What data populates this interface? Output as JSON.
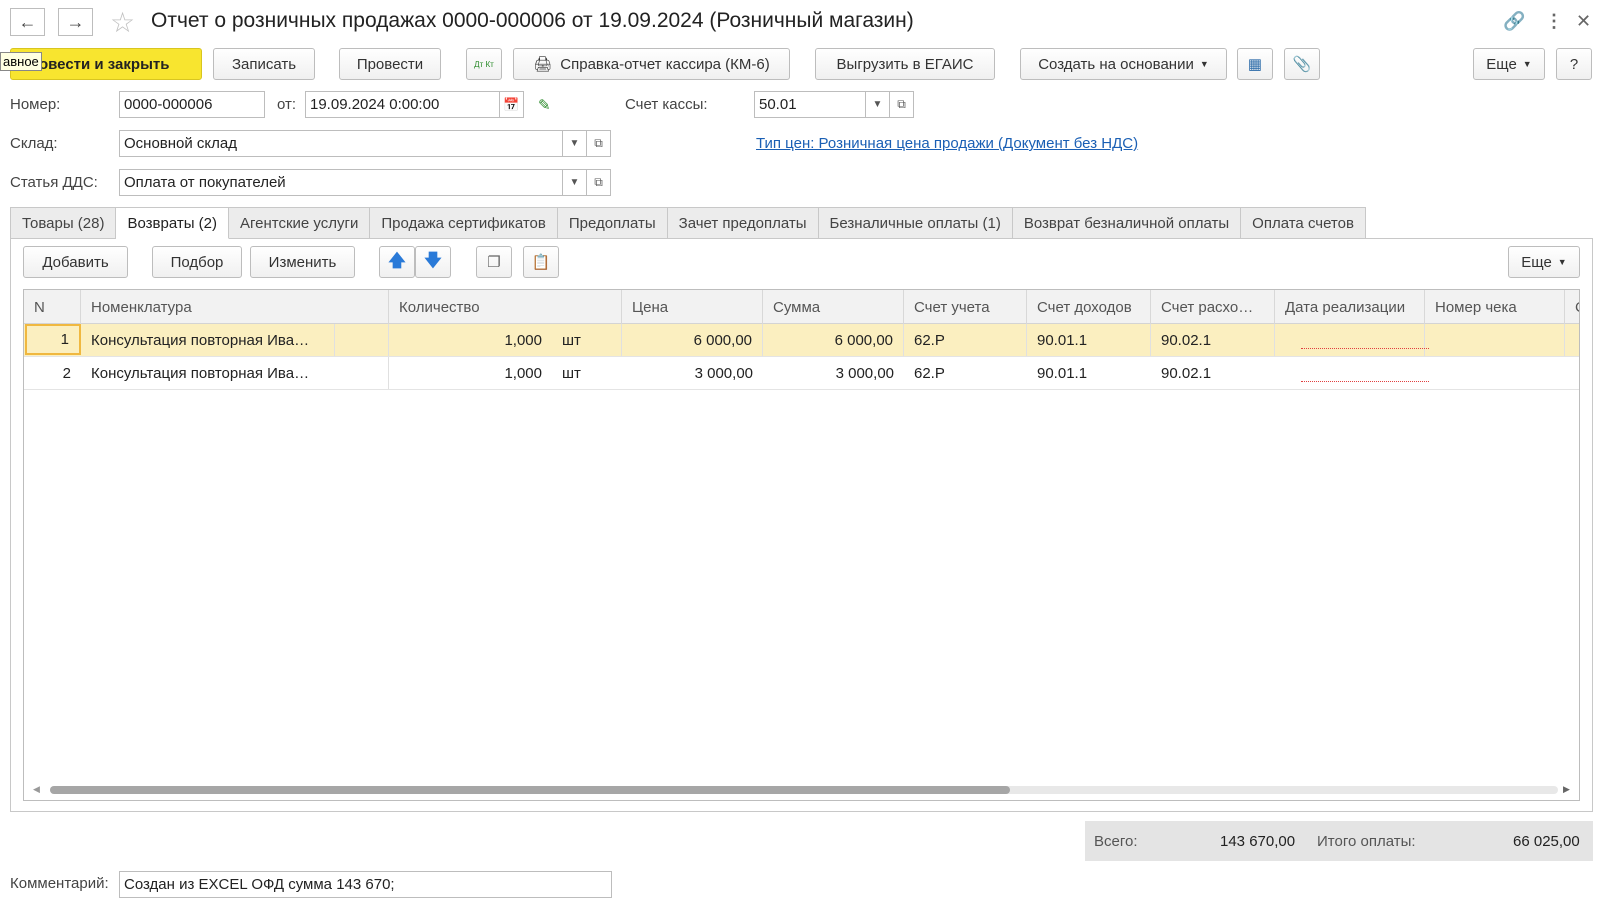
{
  "window": {
    "title": "Отчет о розничных продажах 0000-000006 от 19.09.2024 (Розничный магазин)"
  },
  "toolbar": {
    "tooltip": "авное",
    "post_close": "овести и закрыть",
    "save": "Записать",
    "post": "Провести",
    "dtkt": "Дт Кт",
    "cashier_report": "Справка-отчет кассира (КМ-6)",
    "egais": "Выгрузить в ЕГАИС",
    "create_based": "Создать на основании",
    "more": "Еще",
    "help": "?"
  },
  "form": {
    "number_label": "Номер:",
    "number_value": "0000-000006",
    "from_label": "от:",
    "date_value": "19.09.2024  0:00:00",
    "cash_account_label": "Счет кассы:",
    "cash_account_value": "50.01",
    "warehouse_label": "Склад:",
    "warehouse_value": "Основной склад",
    "price_type_link": "Тип цен: Розничная цена продажи (Документ без НДС)",
    "dds_label": "Статья ДДС:",
    "dds_value": "Оплата от покупателей"
  },
  "tabs": [
    {
      "label": "Товары (28)"
    },
    {
      "label": "Возвраты (2)"
    },
    {
      "label": "Агентские услуги"
    },
    {
      "label": "Продажа сертификатов"
    },
    {
      "label": "Предоплаты"
    },
    {
      "label": "Зачет предоплаты"
    },
    {
      "label": "Безналичные оплаты (1)"
    },
    {
      "label": "Возврат безналичной оплаты"
    },
    {
      "label": "Оплата счетов"
    }
  ],
  "table_toolbar": {
    "add": "Добавить",
    "pick": "Подбор",
    "edit": "Изменить",
    "more": "Еще"
  },
  "table": {
    "columns": [
      "N",
      "Номенклатура",
      "Количество",
      "Цена",
      "Сумма",
      "Счет учета",
      "Счет доходов",
      "Счет расхо…",
      "Дата реализации",
      "Номер чека",
      "С"
    ],
    "rows": [
      {
        "n": "1",
        "name": "Консультация повторная Ива…",
        "qty": "1,000",
        "unit": "шт",
        "price": "6 000,00",
        "sum": "6 000,00",
        "acc": "62.Р",
        "income": "90.01.1",
        "expense": "90.02.1"
      },
      {
        "n": "2",
        "name": "Консультация повторная Ива…",
        "qty": "1,000",
        "unit": "шт",
        "price": "3 000,00",
        "sum": "3 000,00",
        "acc": "62.Р",
        "income": "90.01.1",
        "expense": "90.02.1"
      }
    ]
  },
  "totals": {
    "total_label": "Всего:",
    "total_value": "143 670,00",
    "paid_label": "Итого оплаты:",
    "paid_value": "66 025,00"
  },
  "comment": {
    "label": "Комментарий:",
    "value": "Создан из EXCEL ОФД сумма 143 670;"
  },
  "colors": {
    "primary_button": "#f8e52f",
    "selected_row": "#fbefc0",
    "link": "#1a5fb4"
  }
}
